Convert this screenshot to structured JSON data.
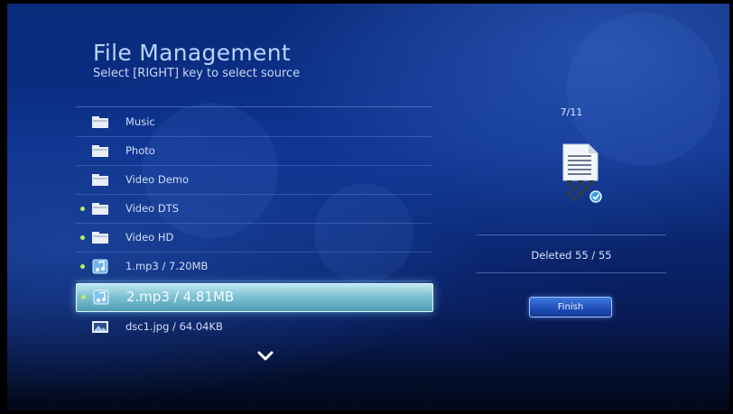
{
  "header": {
    "title": "File Management",
    "subtitle": "Select [RIGHT] key to select source"
  },
  "file_list": {
    "items": [
      {
        "label": "Music",
        "icon": "folder-icon",
        "marked": false,
        "selected": false
      },
      {
        "label": "Photo",
        "icon": "folder-icon",
        "marked": false,
        "selected": false
      },
      {
        "label": "Video Demo",
        "icon": "folder-icon",
        "marked": false,
        "selected": false
      },
      {
        "label": "Video DTS",
        "icon": "folder-icon",
        "marked": true,
        "selected": false
      },
      {
        "label": "Video HD",
        "icon": "folder-icon",
        "marked": true,
        "selected": false
      },
      {
        "label": "1.mp3 / 7.20MB",
        "icon": "music-file-icon",
        "marked": true,
        "selected": false
      },
      {
        "label": "2.mp3 / 4.81MB",
        "icon": "music-file-icon",
        "marked": true,
        "selected": true
      },
      {
        "label": "dsc1.jpg / 64.04KB",
        "icon": "image-file-icon",
        "marked": false,
        "selected": false
      }
    ],
    "scroll_icon": "chevron-down-icon"
  },
  "progress_panel": {
    "counter": "7/11",
    "icon": "document-delete-icon",
    "status": "Deleted 55 / 55",
    "finish_label": "Finish"
  },
  "colors": {
    "background": "#0b2f88",
    "title": "#b9d3ff",
    "selected_row": "#7fc2d2",
    "marked_dot": "#b8f060",
    "finish_button": "#1e4fb8"
  }
}
